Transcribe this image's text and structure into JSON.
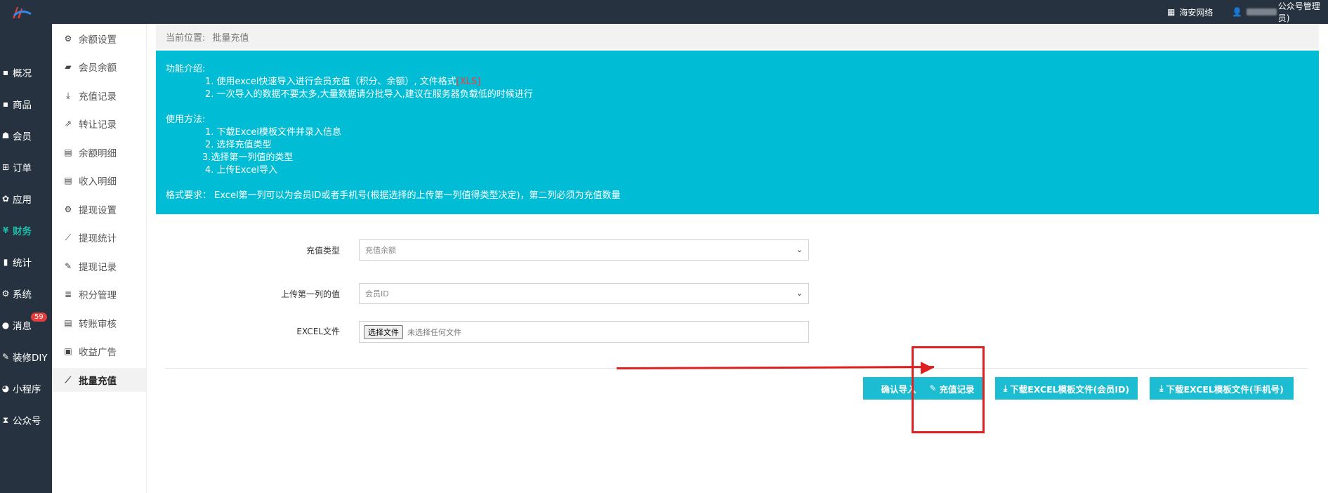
{
  "topbar": {
    "network_label": "海安网络",
    "user_label": "公众号管理员)"
  },
  "nav": {
    "items": [
      {
        "label": "概况",
        "icon": "dashboard-icon"
      },
      {
        "label": "商品",
        "icon": "goods-icon"
      },
      {
        "label": "会员",
        "icon": "users-icon"
      },
      {
        "label": "订单",
        "icon": "cart-icon"
      },
      {
        "label": "应用",
        "icon": "apps-icon"
      },
      {
        "label": "财务",
        "icon": "yen-icon",
        "active": true
      },
      {
        "label": "统计",
        "icon": "bar-chart-icon"
      },
      {
        "label": "系统",
        "icon": "cogs-icon"
      },
      {
        "label": "消息",
        "icon": "message-icon",
        "badge": "59"
      },
      {
        "label": "装修DIY",
        "icon": "brush-icon"
      },
      {
        "label": "小程序",
        "icon": "wechat-icon"
      },
      {
        "label": "公众号",
        "icon": "hourglass-icon"
      }
    ]
  },
  "subnav": {
    "items": [
      {
        "label": "余额设置",
        "icon": "gear-icon"
      },
      {
        "label": "会员余额",
        "icon": "book-icon"
      },
      {
        "label": "充值记录",
        "icon": "download-icon"
      },
      {
        "label": "转让记录",
        "icon": "external-link-icon"
      },
      {
        "label": "余额明细",
        "icon": "file-icon"
      },
      {
        "label": "收入明细",
        "icon": "file-icon"
      },
      {
        "label": "提现设置",
        "icon": "gear-icon"
      },
      {
        "label": "提现统计",
        "icon": "line-chart-icon"
      },
      {
        "label": "提现记录",
        "icon": "pencil-icon"
      },
      {
        "label": "积分管理",
        "icon": "database-icon"
      },
      {
        "label": "转账审核",
        "icon": "file-icon"
      },
      {
        "label": "收益广告",
        "icon": "image-icon"
      },
      {
        "label": "批量充值",
        "icon": "line-chart-icon",
        "active": true
      }
    ]
  },
  "breadcrumb": {
    "prefix": "当前位置:",
    "current": "批量充值"
  },
  "info": {
    "intro_title": "功能介绍:",
    "intro_1_pre": "1. 使用excel快速导入进行会员充值（积分、余额）, 文件格式",
    "intro_1_format": "[XLS]",
    "intro_2": "2. 一次导入的数据不要太多,大量数据请分批导入,建议在服务器负载低的时候进行",
    "usage_title": "使用方法:",
    "usage_1": "1. 下载Excel模板文件并录入信息",
    "usage_2": "2. 选择充值类型",
    "usage_3": "3.选择第一列值的类型",
    "usage_4": "4. 上传Excel导入",
    "format_req": "格式要求：  Excel第一列可以为会员ID或者手机号(根据选择的上传第一列值得类型决定)，第二列必须为充值数量"
  },
  "form": {
    "recharge_type_label": "充值类型",
    "recharge_type_value": "充值余额",
    "first_col_label": "上传第一列的值",
    "first_col_value": "会员ID",
    "excel_label": "EXCEL文件",
    "file_button": "选择文件",
    "file_status": "未选择任何文件"
  },
  "buttons": {
    "confirm_import": "确认导入",
    "recharge_records": "充值记录",
    "download_member_id": "下载EXCEL模板文件(会员ID)",
    "download_phone": "下载EXCEL模板文件(手机号)"
  },
  "colors": {
    "sidebar_bg": "#26323f",
    "accent": "#00bcd4",
    "button": "#1cbdd3",
    "active_nav": "#1fbba6",
    "highlight_red": "#e02020"
  }
}
